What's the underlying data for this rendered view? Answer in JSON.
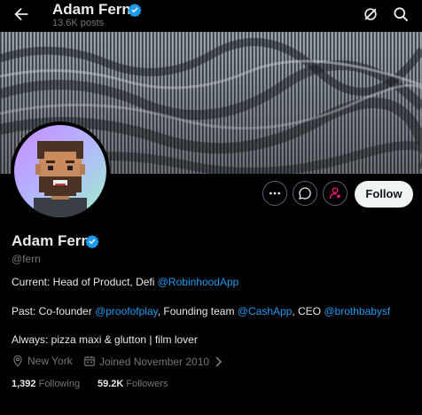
{
  "header": {
    "name": "Adam Fern",
    "posts": "13.6K posts"
  },
  "actions": {
    "follow_label": "Follow"
  },
  "profile": {
    "name": "Adam Fern",
    "handle": "@fern",
    "bio": {
      "line1_prefix": "Current: Head of Product, Defi ",
      "line1_link": "@RobinhoodApp",
      "line2_prefix": "Past: Co-founder ",
      "line2_link1": "@proofofplay",
      "line2_mid1": ", Founding team ",
      "line2_link2": "@CashApp",
      "line2_mid2": ", CEO ",
      "line2_link3": "@brothbabysf",
      "line3": "Always: pizza maxi & glutton | film lover"
    },
    "location": "New York",
    "joined": "Joined November 2010",
    "following_count": "1,392",
    "following_label": "Following",
    "followers_count": "59.2K",
    "followers_label": "Followers"
  },
  "colors": {
    "accent": "#1d9bf0",
    "background": "#000000",
    "text": "#e7e9ea",
    "muted": "#71767b",
    "subscribe_pink": "#f91880"
  },
  "icons": [
    "back-arrow-icon",
    "verified-badge-icon",
    "grok-icon",
    "search-icon",
    "more-icon",
    "message-icon",
    "subscribe-icon",
    "location-icon",
    "calendar-icon",
    "chevron-right-icon"
  ]
}
